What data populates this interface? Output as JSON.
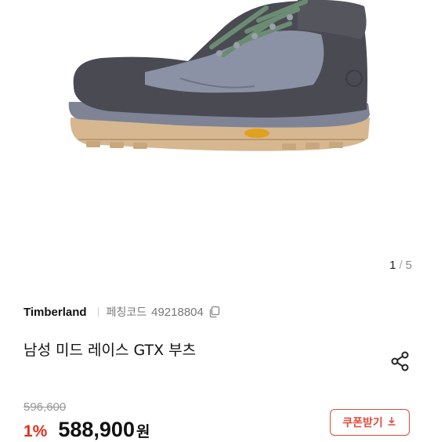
{
  "gallery": {
    "image": "boot-product-image",
    "current": "1",
    "separator": "/",
    "total": "5"
  },
  "product": {
    "brand": "Timberland",
    "code_label": "페칭코드",
    "code_value": "49218804",
    "title": "남성 미드 레이스 GTX 부츠",
    "original_price": "596,600",
    "discount": "1%",
    "price": "588,900",
    "currency": "원"
  },
  "actions": {
    "coupon_label": "쿠폰받기",
    "copy_icon": "copy-icon",
    "share_icon": "share-icon",
    "download_icon": "download-icon"
  },
  "colors": {
    "accent": "#e04a3a",
    "discount": "#e0321d",
    "boot_suede": "#4a4a52",
    "boot_panel": "#8a90a4",
    "sole": "#d4b48c",
    "laces": "#6a8a72"
  }
}
